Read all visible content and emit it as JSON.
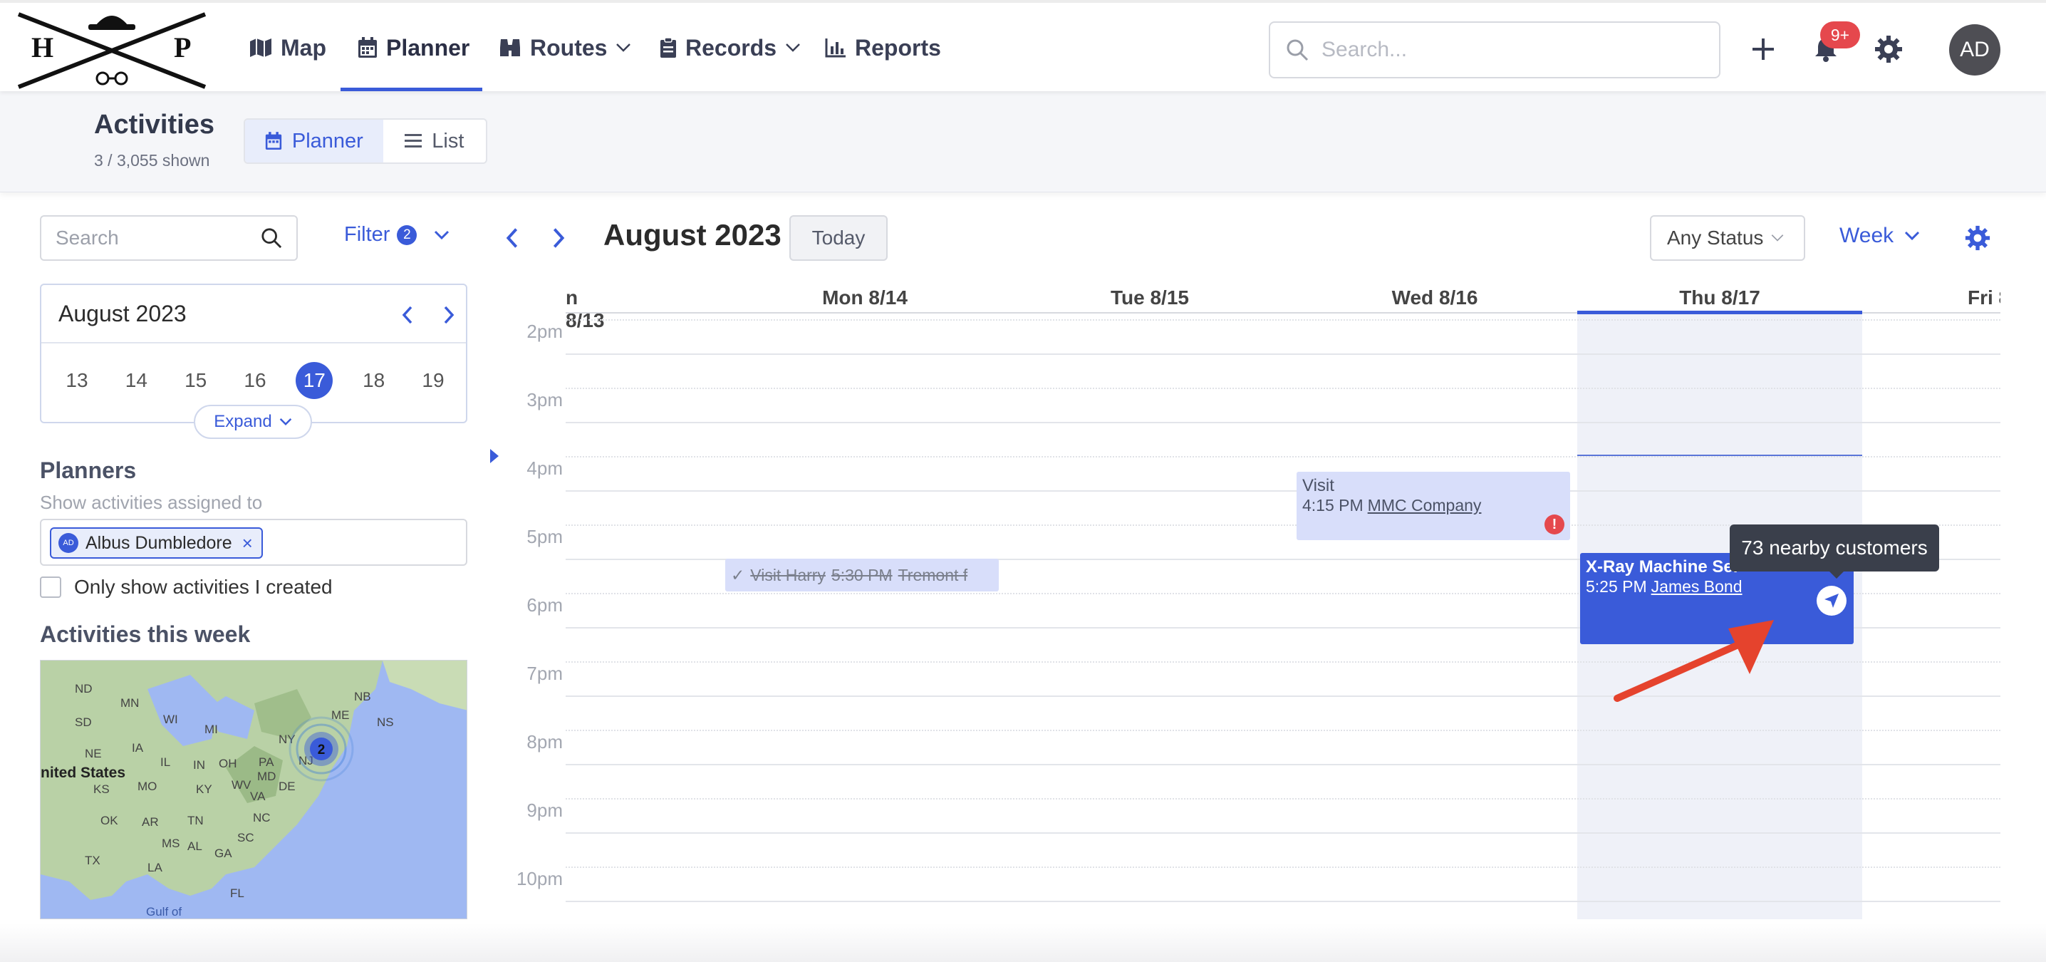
{
  "nav": {
    "items": [
      {
        "label": "Map",
        "icon": "map-icon"
      },
      {
        "label": "Planner",
        "icon": "calendar-icon",
        "active": true
      },
      {
        "label": "Routes",
        "icon": "binoculars-icon",
        "has_dropdown": true
      },
      {
        "label": "Records",
        "icon": "clipboard-icon",
        "has_dropdown": true
      },
      {
        "label": "Reports",
        "icon": "bar-chart-icon"
      }
    ],
    "search_placeholder": "Search...",
    "notification_count": "9+",
    "avatar_initials": "AD",
    "accent_color": "#3a5bd9"
  },
  "subheader": {
    "title": "Activities",
    "shown_count": "3 / 3,055 shown",
    "views": [
      {
        "label": "Planner",
        "active": true
      },
      {
        "label": "List",
        "active": false
      }
    ]
  },
  "sidebar": {
    "search_placeholder": "Search",
    "filter_label": "Filter",
    "filter_count": "2",
    "mini_calendar": {
      "month": "August 2023",
      "days": [
        "13",
        "14",
        "15",
        "16",
        "17",
        "18",
        "19"
      ],
      "selected_day": "17",
      "expand_label": "Expand"
    },
    "planners": {
      "title": "Planners",
      "subtitle": "Show activities assigned to",
      "selected": [
        {
          "initials": "AD",
          "name": "Albus Dumbledore"
        }
      ]
    },
    "only_mine_label": "Only show activities I created",
    "week_title": "Activities this week",
    "map": {
      "state_labels": [
        "ND",
        "MN",
        "SD",
        "WI",
        "MI",
        "NE",
        "IA",
        "IL",
        "IN",
        "OH",
        "PA",
        "NY",
        "NJ",
        "MD",
        "DE",
        "WV",
        "VA",
        "KY",
        "MO",
        "KS",
        "OK",
        "AR",
        "TN",
        "NC",
        "SC",
        "MS",
        "AL",
        "GA",
        "TX",
        "LA",
        "FL",
        "ME",
        "NB",
        "NS"
      ],
      "country_label": "nited States",
      "gulf_label": "Gulf of",
      "cluster_count": "2"
    }
  },
  "calendar": {
    "month_label": "August 2023",
    "today_label": "Today",
    "status_filter": "Any Status",
    "view_mode": "Week",
    "days": [
      "n 8/13",
      "Mon 8/14",
      "Tue 8/15",
      "Wed 8/16",
      "Thu 8/17",
      "Fri 8"
    ],
    "today_index": 4,
    "hours": [
      "2pm",
      "3pm",
      "4pm",
      "5pm",
      "6pm",
      "7pm",
      "8pm",
      "9pm",
      "10pm"
    ],
    "events": {
      "visit": {
        "title": "Visit",
        "time": "4:15 PM",
        "customer": "MMC Company",
        "has_alert": true,
        "alert_symbol": "!"
      },
      "completed": {
        "check": "✓",
        "title": "Visit Harry",
        "time": "5:30 PM",
        "customer": "Tremont f"
      },
      "xray": {
        "title": "X-Ray Machine Ser",
        "time": "5:25 PM",
        "customer": "James Bond"
      }
    },
    "tooltip": "73 nearby customers"
  }
}
